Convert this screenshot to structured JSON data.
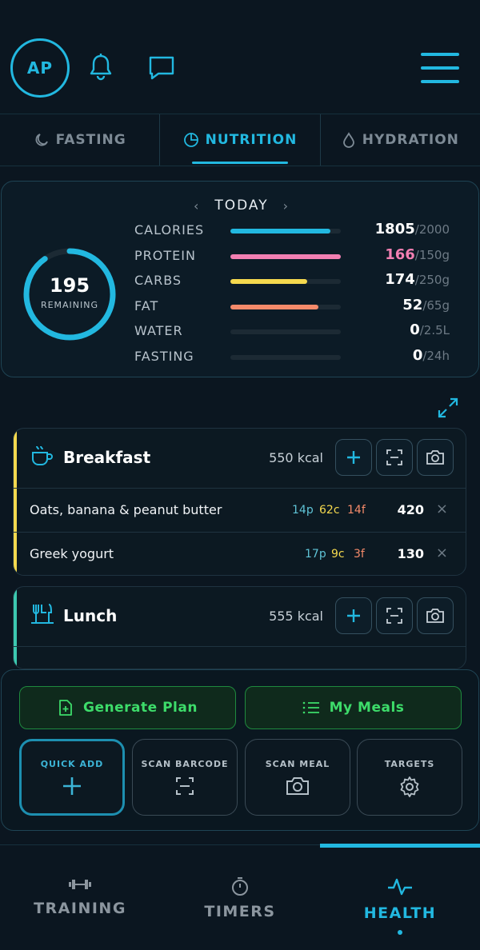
{
  "header": {
    "avatar_initials": "AP"
  },
  "tabs": [
    {
      "label": "FASTING",
      "icon": "moon-icon",
      "active": false
    },
    {
      "label": "NUTRITION",
      "icon": "pie-chart-icon",
      "active": true
    },
    {
      "label": "HYDRATION",
      "icon": "droplet-icon",
      "active": false
    }
  ],
  "summary": {
    "day_label": "TODAY",
    "prev": "‹",
    "next": "›",
    "remaining_value": "195",
    "remaining_label": "REMAINING",
    "ring_fraction": 0.9025,
    "metrics": [
      {
        "label": "CALORIES",
        "value": "1805",
        "goal": "/2000",
        "fraction": 0.9025,
        "color": "#22b8e0",
        "value_color": "#ffffff"
      },
      {
        "label": "PROTEIN",
        "value": "166",
        "goal": "/150g",
        "fraction": 1.0,
        "color": "#f27fb2",
        "value_color": "#f27fb2"
      },
      {
        "label": "CARBS",
        "value": "174",
        "goal": "/250g",
        "fraction": 0.696,
        "color": "#f5d94e",
        "value_color": "#ffffff"
      },
      {
        "label": "FAT",
        "value": "52",
        "goal": "/65g",
        "fraction": 0.8,
        "color": "#f58a6a",
        "value_color": "#ffffff"
      },
      {
        "label": "WATER",
        "value": "0",
        "goal": "/2.5L",
        "fraction": 0,
        "color": "#22b8e0",
        "value_color": "#ffffff"
      },
      {
        "label": "FASTING",
        "value": "0",
        "goal": "/24h",
        "fraction": 0,
        "color": "#22b8e0",
        "value_color": "#ffffff"
      }
    ]
  },
  "meals": [
    {
      "title": "Breakfast",
      "kcal": "550 kcal",
      "accent": "#f5d94e",
      "icon": "coffee-cup-icon",
      "items": [
        {
          "name": "Oats, banana & peanut butter",
          "p": "14p",
          "c": "62c",
          "f": "14f",
          "cal": "420"
        },
        {
          "name": "Greek yogurt",
          "p": "17p",
          "c": "9c",
          "f": "3f",
          "cal": "130"
        }
      ]
    },
    {
      "title": "Lunch",
      "kcal": "555 kcal",
      "accent": "#3cc9b0",
      "icon": "utensils-icon",
      "items": []
    }
  ],
  "actions": {
    "generate_plan": "Generate Plan",
    "my_meals": "My Meals",
    "tiles": [
      {
        "label": "QUICK ADD",
        "icon": "plus-icon",
        "selected": true
      },
      {
        "label": "SCAN BARCODE",
        "icon": "barcode-scan-icon",
        "selected": false
      },
      {
        "label": "SCAN MEAL",
        "icon": "camera-icon",
        "selected": false
      },
      {
        "label": "TARGETS",
        "icon": "gear-icon",
        "selected": false
      }
    ]
  },
  "bottom_nav": [
    {
      "label": "TRAINING",
      "icon": "dumbbell-icon",
      "active": false
    },
    {
      "label": "TIMERS",
      "icon": "stopwatch-icon",
      "active": false
    },
    {
      "label": "HEALTH",
      "icon": "pulse-icon",
      "active": true
    }
  ]
}
